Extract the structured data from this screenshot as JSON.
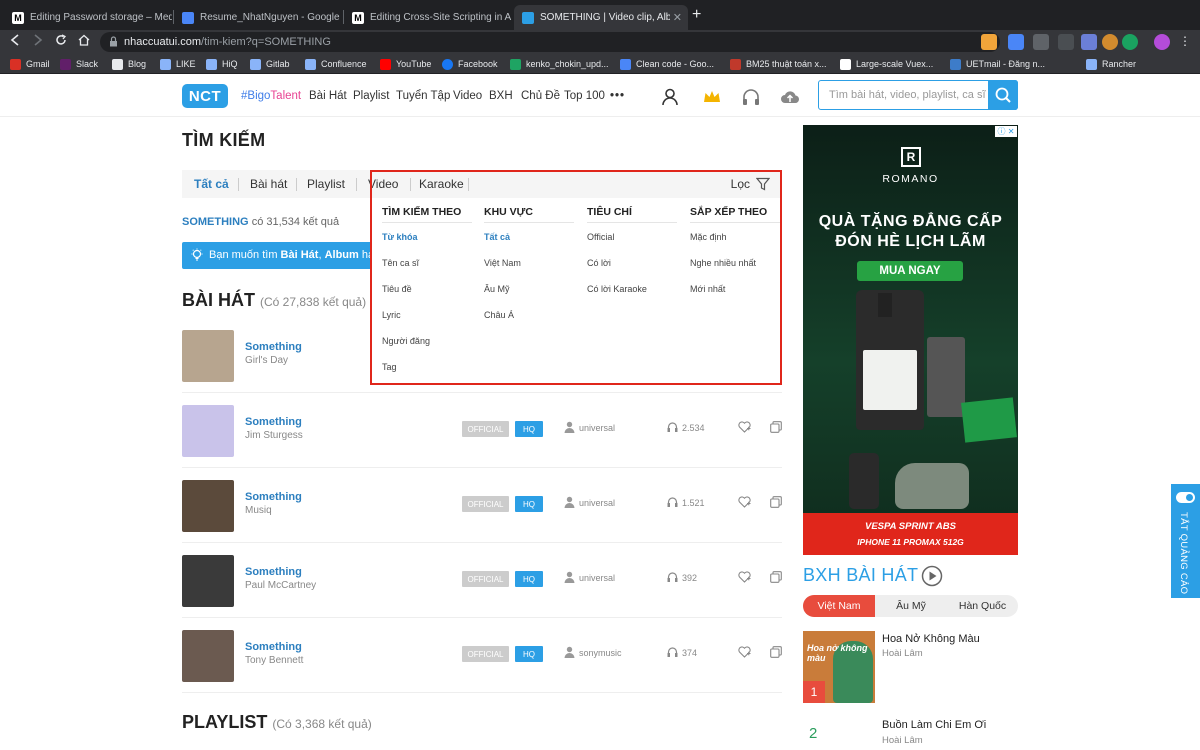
{
  "browser": {
    "tabs": [
      {
        "label": "Editing Password storage – Med",
        "icon": "M"
      },
      {
        "label": "Resume_NhatNguyen - Google D",
        "icon": "doc"
      },
      {
        "label": "Editing Cross-Site Scripting in A",
        "icon": "M"
      },
      {
        "label": "SOMETHING | Video clip, Album",
        "icon": "nct"
      }
    ],
    "url_host": "nhaccuatui.com",
    "url_path": "/tim-kiem?q=SOMETHING",
    "bookmarks": [
      "Gmail",
      "Slack",
      "Blog",
      "LIKE",
      "HiQ",
      "Gitlab",
      "Confluence",
      "YouTube",
      "Facebook",
      "kenko_chokin_upd...",
      "Clean code - Goo...",
      "BM25 thuật toán x...",
      "Large-scale Vuex...",
      "UETmail - Đăng n...",
      "Rancher"
    ]
  },
  "site": {
    "logo": "NCT",
    "nav_talent_prefix": "#Bigo",
    "nav_talent_suffix": "Talent",
    "nav": [
      "Bài Hát",
      "Playlist",
      "Tuyển Tập",
      "Video",
      "BXH",
      "Chủ Đề",
      "Top 100",
      "•••"
    ],
    "search_placeholder": "Tìm bài hát, video, playlist, ca sĩ"
  },
  "search": {
    "page_title": "TÌM KIẾM",
    "tabs": [
      "Tất cả",
      "Bài hát",
      "Playlist",
      "Video",
      "Karaoke"
    ],
    "filter_label": "Lọc",
    "query": "SOMETHING",
    "result_count_text": "có 31,534 kết quả",
    "hint_prefix": "Bạn muốn tìm ",
    "hint_bold1": "Bài Hát",
    "hint_sep": ", ",
    "hint_bold2": "Album",
    "hint_suffix": " hay V"
  },
  "filter_dropdown": {
    "columns": [
      {
        "heading": "TÌM KIẾM THEO",
        "items": [
          "Từ khóa",
          "Tên ca sĩ",
          "Tiêu đề",
          "Lyric",
          "Người đăng",
          "Tag"
        ],
        "active": 0
      },
      {
        "heading": "KHU VỰC",
        "items": [
          "Tất cả",
          "Việt Nam",
          "Âu Mỹ",
          "Châu Á"
        ],
        "active": 0
      },
      {
        "heading": "TIÊU CHÍ",
        "items": [
          "Official",
          "Có lời",
          "Có lời Karaoke"
        ],
        "active": -1
      },
      {
        "heading": "SẮP XẾP THEO",
        "items": [
          "Mặc định",
          "Nghe nhiều nhất",
          "Mới nhất"
        ],
        "active": -1
      }
    ]
  },
  "songs_section": {
    "title": "BÀI HÁT",
    "count": "(Có 27,838 kết quả)",
    "badge_official": "OFFICIAL",
    "badge_hq": "HQ",
    "items": [
      {
        "title": "Something",
        "artist": "Girl's Day",
        "uploader": "",
        "listens": "",
        "thumb_color": "#b7a58f"
      },
      {
        "title": "Something",
        "artist": "Jim Sturgess",
        "uploader": "universal",
        "listens": "2.534",
        "thumb_color": "#c9c3ea"
      },
      {
        "title": "Something",
        "artist": "Musiq",
        "uploader": "universal",
        "listens": "1.521",
        "thumb_color": "#5b4a3b"
      },
      {
        "title": "Something",
        "artist": "Paul McCartney",
        "uploader": "universal",
        "listens": "392",
        "thumb_color": "#3a3a3a"
      },
      {
        "title": "Something",
        "artist": "Tony Bennett",
        "uploader": "sonymusic",
        "listens": "374",
        "thumb_color": "#6b5a50"
      }
    ]
  },
  "playlist_section": {
    "title": "PLAYLIST",
    "count": "(Có 3,368 kết quả)"
  },
  "ad": {
    "brand_logo": "R",
    "brand": "ROMANO",
    "promo_line1": "QUÀ TẶNG ĐẲNG CẤP",
    "promo_line2": "ĐÓN HÈ LỊCH LÃM",
    "cta": "MUA NGAY",
    "bottom_line1": "VESPA SPRINT ABS",
    "bottom_line2": "IPHONE 11 PROMAX 512G",
    "adchoices": "ⓘ ✕"
  },
  "chart": {
    "title": "BXH BÀI HÁT",
    "tabs": [
      "Việt Nam",
      "Âu Mỹ",
      "Hàn Quốc"
    ],
    "items": [
      {
        "rank": "1",
        "title": "Hoa Nở Không Màu",
        "artist": "Hoài Lâm",
        "thumb_text": "Hoa nở không màu"
      },
      {
        "rank": "2",
        "title": "Buồn Làm Chi Em Ơi",
        "artist": "Hoài Lâm"
      }
    ]
  },
  "ad_toggle_label": "TẮT QUẢNG CÁO",
  "colors": {
    "brand_blue": "#2c9fe5",
    "link_blue": "#2c7fbf",
    "highlight_red": "#e0261b",
    "chart_red": "#e84c3d"
  }
}
